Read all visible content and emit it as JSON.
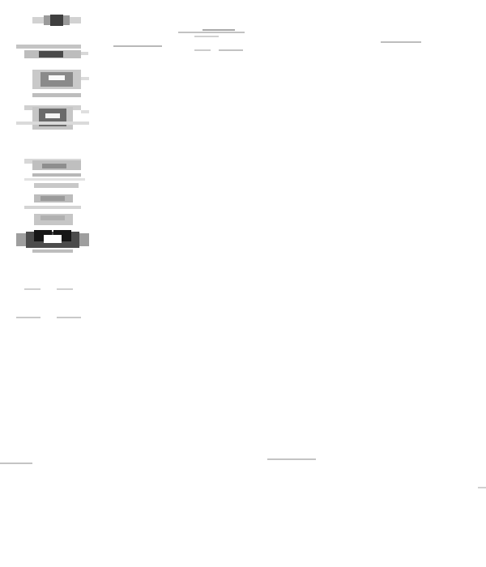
{
  "window": {
    "left_items": [
      {
        "name": "nav-label-1",
        "text": ""
      },
      {
        "name": "nav-label-2",
        "text": ""
      },
      {
        "name": "nav-label-3",
        "text": ""
      },
      {
        "name": "nav-label-4",
        "text": ""
      },
      {
        "name": "nav-label-5",
        "text": ""
      },
      {
        "name": "nav-label-6",
        "text": ""
      },
      {
        "name": "nav-label-7",
        "text": ""
      },
      {
        "name": "nav-label-8",
        "text": ""
      },
      {
        "name": "nav-label-9",
        "text": ""
      }
    ],
    "bottom_left_items": [
      {
        "name": "footer-label-1",
        "text": ""
      },
      {
        "name": "footer-label-2",
        "text": ""
      },
      {
        "name": "footer-label-3",
        "text": ""
      }
    ]
  },
  "header": {
    "title": "",
    "subtitle": "",
    "top_right_label": "",
    "center_label": ""
  },
  "content": {
    "center_caption": "",
    "left_edge_label": "",
    "right_edge_label": ""
  },
  "icons": [
    "app-icon",
    "folder-icon",
    "document-icon",
    "settings-icon",
    "list-icon",
    "grid-icon",
    "image-icon",
    "user-icon"
  ]
}
